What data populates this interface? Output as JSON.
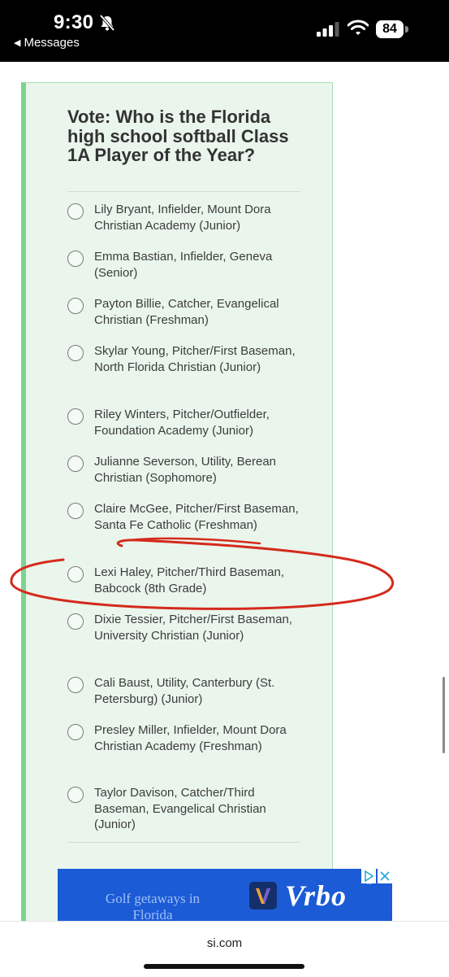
{
  "status_bar": {
    "time": "9:30",
    "back_label": "Messages",
    "battery": "84"
  },
  "poll": {
    "title": "Vote: Who is the Florida high school softball Class 1A Player of the Year?",
    "options": [
      "Lily Bryant, Infielder, Mount Dora Christian Academy (Junior)",
      "Emma Bastian, Infielder, Geneva (Senior)",
      "Payton Billie, Catcher, Evangelical Christian (Freshman)",
      "Skylar Young, Pitcher/First Baseman, North Florida Christian (Junior)",
      "Riley Winters, Pitcher/Outfielder, Foundation Academy (Junior)",
      "Julianne Severson, Utility, Berean Christian (Sophomore)",
      "Claire McGee, Pitcher/First Baseman, Santa Fe Catholic (Freshman)",
      "Lexi Haley, Pitcher/Third Baseman, Babcock (8th Grade)",
      "Dixie Tessier, Pitcher/First Baseman, University Christian (Junior)",
      "Cali Baust, Utility, Canterbury (St. Petersburg) (Junior)",
      "Presley Miller, Infielder, Mount Dora Christian Academy (Freshman)",
      "Taylor Davison, Catcher/Third Baseman, Evangelical Christian (Junior)"
    ]
  },
  "ad": {
    "text": "Golf getaways in Florida",
    "brand": "Vrbo"
  },
  "browser": {
    "url": "si.com"
  },
  "colors": {
    "card_bg": "#eaf6ec",
    "card_accent": "#7ed38f",
    "annotation": "#d42a1c",
    "ad_bg": "#1c5bd6"
  }
}
